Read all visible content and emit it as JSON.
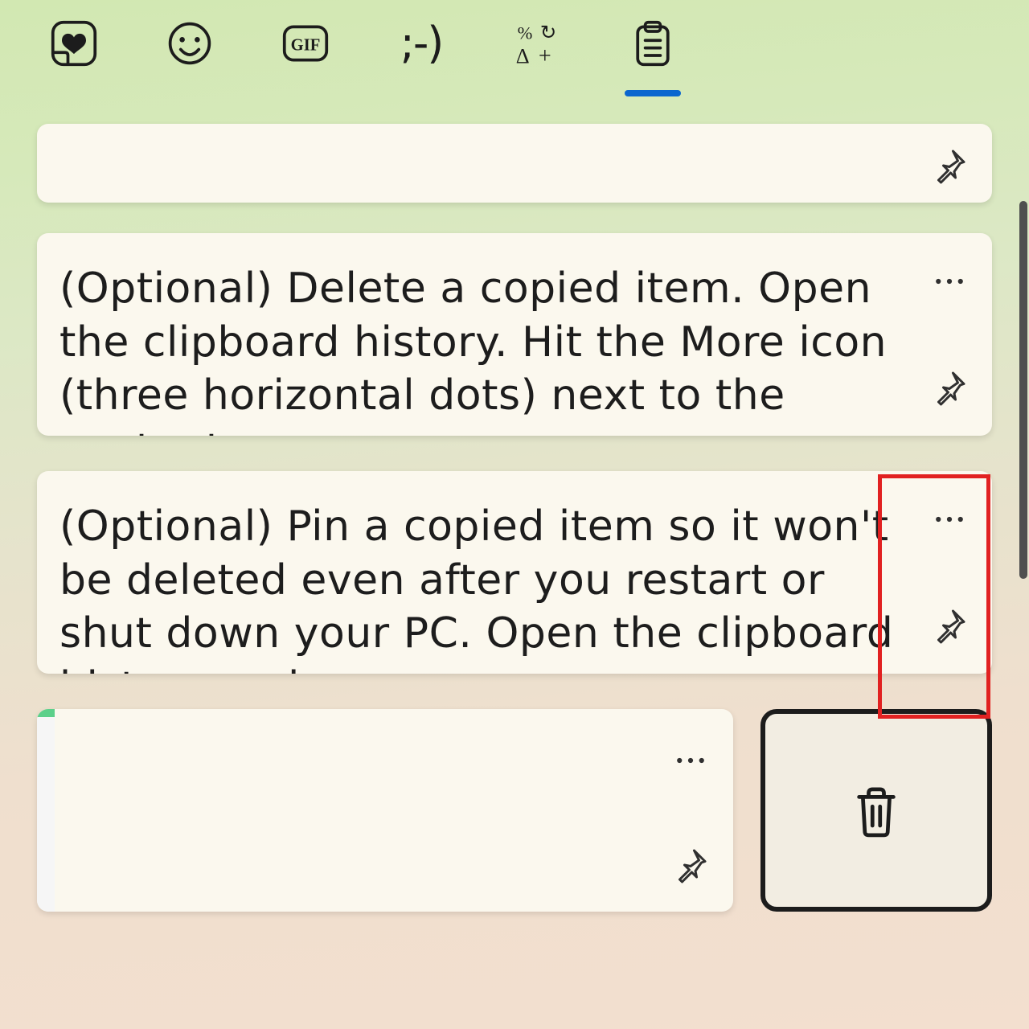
{
  "tabs": [
    {
      "name": "stickers",
      "icon": "sticker-heart"
    },
    {
      "name": "emoji",
      "icon": "smile"
    },
    {
      "name": "gif",
      "icon": "gif"
    },
    {
      "name": "kaomoji",
      "icon": "kaomoji"
    },
    {
      "name": "symbols",
      "icon": "symbols"
    },
    {
      "name": "clipboard",
      "icon": "clipboard",
      "active": true
    }
  ],
  "clipboard_items": [
    {
      "id": "item0",
      "kind": "text",
      "text": ""
    },
    {
      "id": "item1",
      "kind": "text",
      "text": "(Optional) Delete a copied item. Open the clipboard history. Hit the More icon (three horizontal dots) next to the content you w"
    },
    {
      "id": "item2",
      "kind": "text",
      "text": "(Optional) Pin a copied item so it won't be deleted even after you restart or shut down your PC. Open the clipboard history and",
      "highlighted": true
    },
    {
      "id": "item3",
      "kind": "image",
      "menu_open": true
    }
  ],
  "colors": {
    "accent": "#0a66cf",
    "highlight_border": "#e12121"
  }
}
